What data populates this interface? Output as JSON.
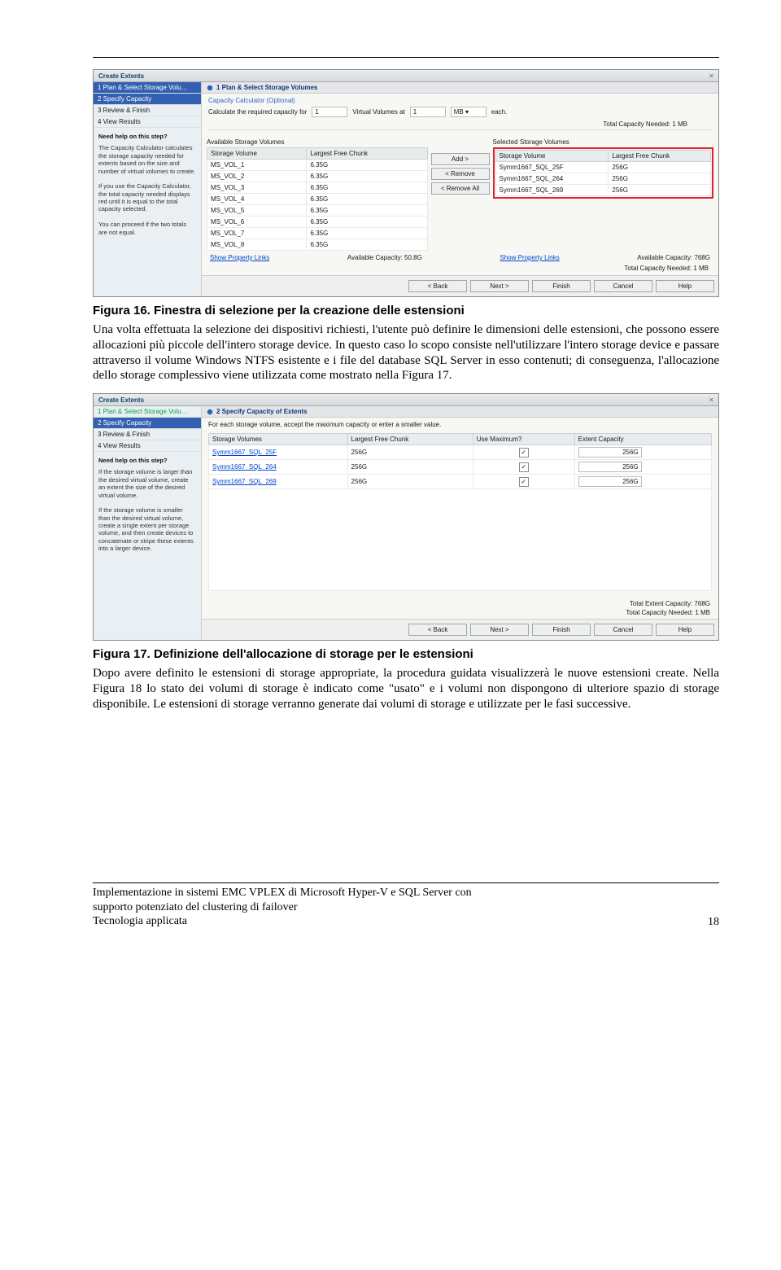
{
  "caption1": "Figura 16. Finestra di selezione per la creazione delle estensioni",
  "para1": "Una volta effettuata la selezione dei dispositivi richiesti, l'utente può definire le dimensioni delle estensioni, che possono essere allocazioni più piccole dell'intero storage device. In questo caso lo scopo consiste nell'utilizzare l'intero storage device e passare attraverso il volume Windows NTFS esistente e i file del database SQL Server in esso contenuti; di conseguenza, l'allocazione dello storage complessivo viene utilizzata come mostrato nella Figura 17.",
  "dlg1": {
    "title": "Create Extents",
    "steps": [
      "1  Plan & Select Storage Volu…",
      "2  Specify Capacity",
      "3  Review & Finish",
      "4  View Results"
    ],
    "helpTitle": "Need help on this step?",
    "helpBody": "The Capacity Calculator calculates the storage capacity needed for extents based on the size and number of virtual volumes to create.\n\nIf you use the Capacity Calculator, the total capacity needed displays red until it is equal to the total capacity selected.\n\nYou can proceed if the two totals are not equal.",
    "header": "1 Plan & Select Storage Volumes",
    "calcTitle": "Capacity Calculator (Optional)",
    "calcLine": "Calculate the required capacity for",
    "calcVal1": "1",
    "calcMid": "Virtual Volumes at",
    "calcVal2": "1",
    "calcUnit": "MB",
    "calcEach": "each.",
    "needed": "Total Capacity Needed: 1 MB",
    "availLabel": "Available Storage Volumes",
    "selLabel": "Selected Storage Volumes",
    "colVol": "Storage Volume",
    "colFree": "Largest Free Chunk",
    "avail": [
      [
        "MS_VOL_1",
        "6.35G"
      ],
      [
        "MS_VOL_2",
        "6.35G"
      ],
      [
        "MS_VOL_3",
        "6.35G"
      ],
      [
        "MS_VOL_4",
        "6.35G"
      ],
      [
        "MS_VOL_5",
        "6.35G"
      ],
      [
        "MS_VOL_6",
        "6.35G"
      ],
      [
        "MS_VOL_7",
        "6.35G"
      ],
      [
        "MS_VOL_8",
        "6.35G"
      ]
    ],
    "selected": [
      [
        "Symm1667_SQL_25F",
        "256G"
      ],
      [
        "Symm1667_SQL_264",
        "256G"
      ],
      [
        "Symm1667_SQL_269",
        "256G"
      ]
    ],
    "btnAdd": "Add >",
    "btnRemove": "< Remove",
    "btnRemoveAll": "< Remove All",
    "propLink": "Show Property Links",
    "capLeft": "Available Capacity: 50.8G",
    "capRight": "Available Capacity: 768G",
    "neededBottom": "Total Capacity Needed: 1 MB",
    "buttons": [
      "< Back",
      "Next >",
      "Finish",
      "Cancel",
      "Help"
    ]
  },
  "dlg2": {
    "title": "Create Extents",
    "steps": [
      "1  Plan & Select Storage Volu…",
      "2  Specify Capacity",
      "3  Review & Finish",
      "4  View Results"
    ],
    "helpTitle": "Need help on this step?",
    "helpBody": "If the storage volume is larger than the desired virtual volume, create an extent the size of the desired virtual volume.\n\nIf the storage volume is smaller than the desired virtual volume, create a single extent per storage volume, and then create devices to concatenate or stripe these extents into a larger device.",
    "header": "2 Specify Capacity of Extents",
    "instr": "For each storage volume, accept the maximum capacity or enter a smaller value.",
    "colVol": "Storage Volumes",
    "colFree": "Largest Free Chunk",
    "colUse": "Use Maximum?",
    "colExt": "Extent Capacity",
    "rows": [
      [
        "Symm1667_SQL_25F",
        "256G",
        "256G"
      ],
      [
        "Symm1667_SQL_264",
        "256G",
        "256G"
      ],
      [
        "Symm1667_SQL_269",
        "256G",
        "256G"
      ]
    ],
    "totExt": "Total Extent Capacity: 768G",
    "needed": "Total Capacity Needed: 1 MB",
    "buttons": [
      "< Back",
      "Next >",
      "Finish",
      "Cancel",
      "Help"
    ]
  },
  "caption2": "Figura 17. Definizione dell'allocazione di storage per le estensioni",
  "para2": "Dopo avere definito le estensioni di storage appropriate, la procedura guidata visualizzerà le nuove estensioni create. Nella Figura 18 lo stato dei volumi di storage è indicato come \"usato\" e i volumi non dispongono di ulteriore spazio di storage disponibile. Le estensioni di storage verranno generate dai volumi di storage e utilizzate per le fasi successive.",
  "footer1": "Implementazione in sistemi EMC VPLEX di Microsoft Hyper-V e SQL Server con",
  "footer2": "supporto potenziato del clustering di failover",
  "footer3": "Tecnologia applicata",
  "page": "18"
}
